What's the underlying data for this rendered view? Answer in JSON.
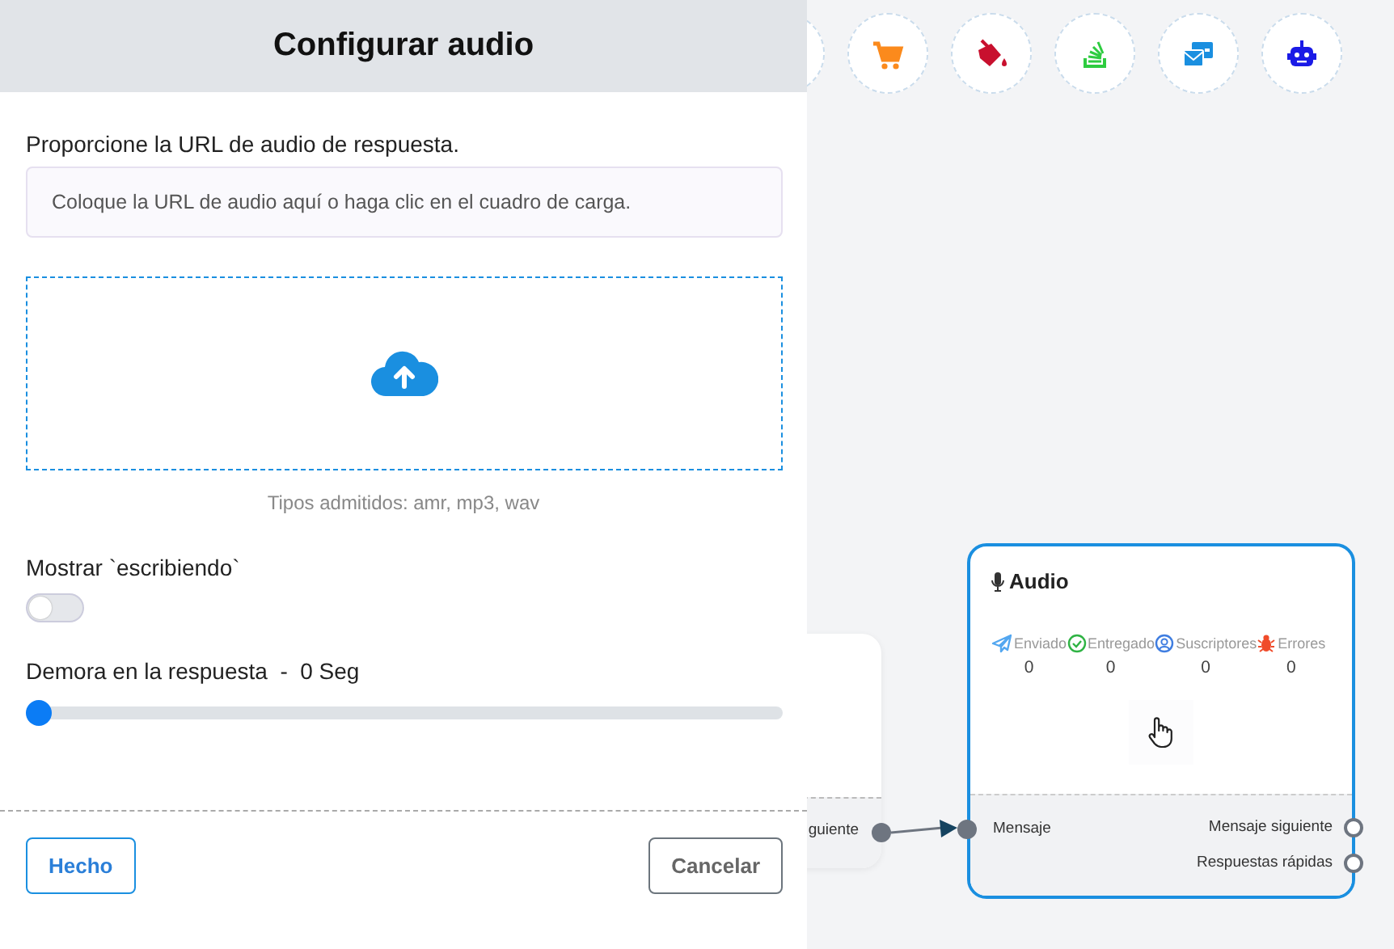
{
  "panel": {
    "title": "Configurar audio",
    "url_label": "Proporcione la URL de audio de respuesta.",
    "url_placeholder": "Coloque la URL de audio aquí o haga clic en el cuadro de carga.",
    "upload_hint": "Tipos admitidos: amr, mp3, wav",
    "typing_label": "Mostrar `escribiendo`",
    "typing_on": false,
    "delay_label": "Demora en la respuesta  -  0 Seg",
    "delay": {
      "level": 0
    },
    "buttons": [
      {
        "label": "Hecho",
        "kind": "primary"
      },
      {
        "label": "Cancelar",
        "kind": "secondary"
      }
    ]
  },
  "canvas": {
    "previous_node": {
      "output": "guiente"
    },
    "audio_node": {
      "title": "Audio",
      "stats": [
        {
          "label": "Enviado",
          "value": "0",
          "kind": "sent"
        },
        {
          "label": "Entregado",
          "value": "0",
          "kind": "delivered"
        },
        {
          "label": "Suscriptores",
          "value": "0",
          "kind": "subscribers"
        },
        {
          "label": "Errores",
          "value": "0",
          "kind": "errors"
        }
      ],
      "input": "Mensaje",
      "outputs": [
        "Mensaje siguiente",
        "Respuestas rápidas"
      ]
    }
  }
}
